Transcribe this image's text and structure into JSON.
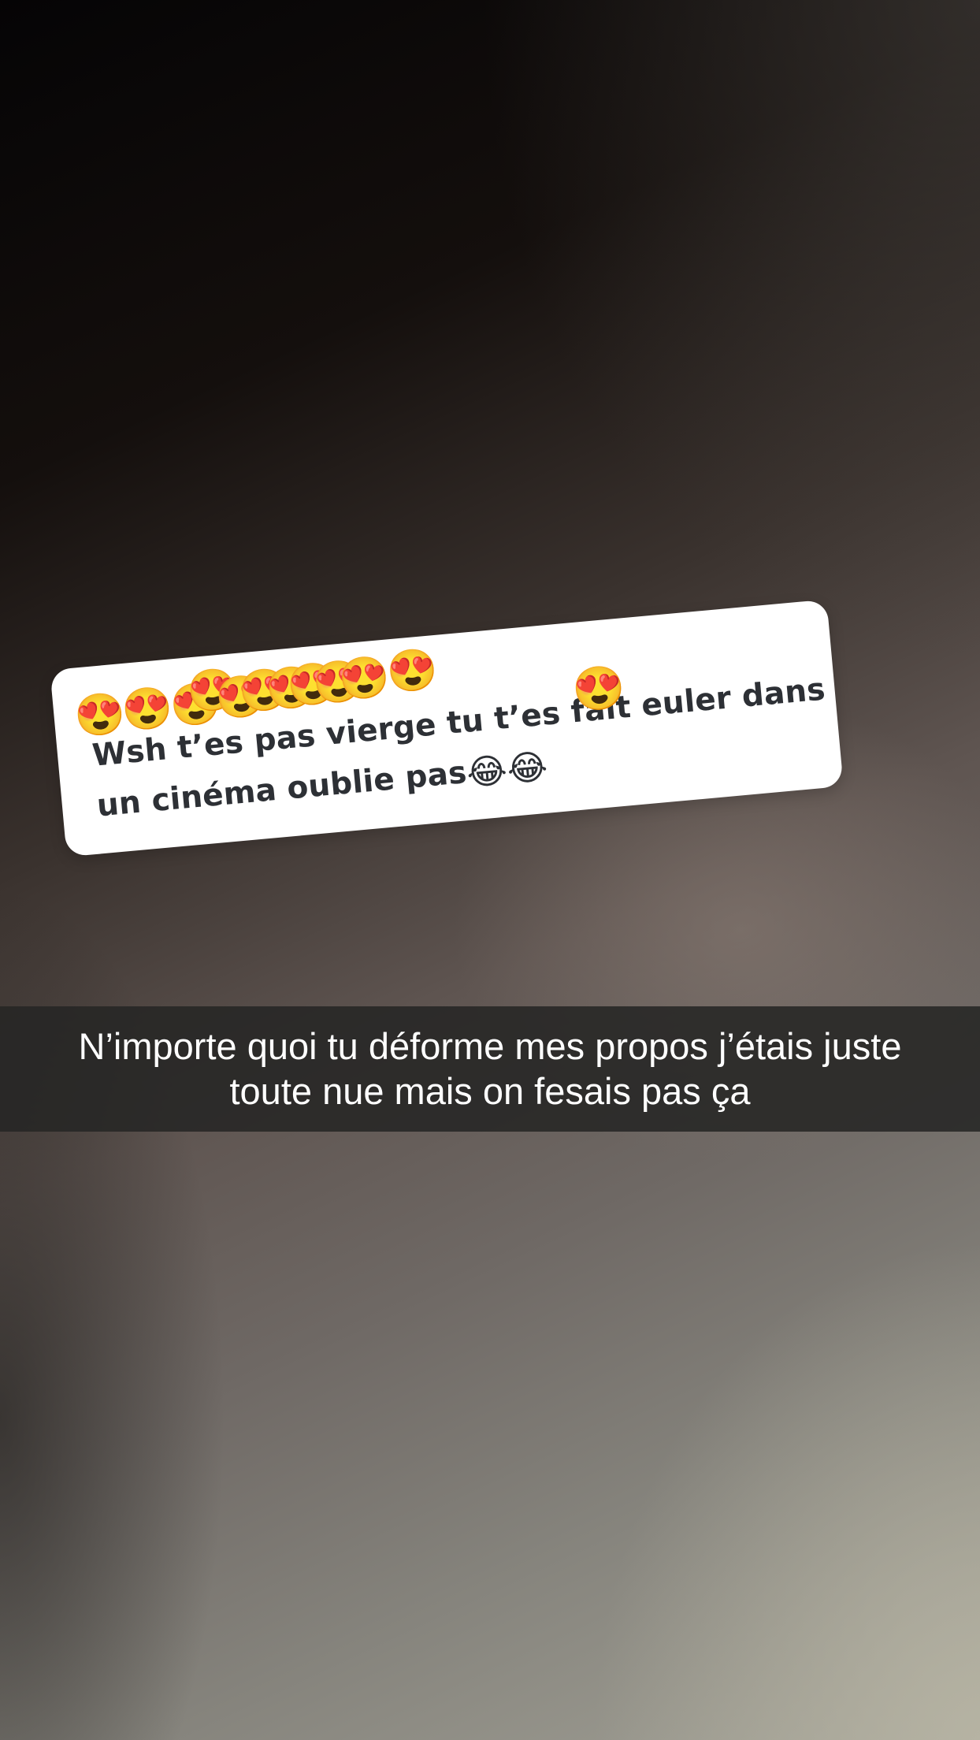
{
  "question_sticker": {
    "reaction_emojis": [
      "😍",
      "😍",
      "😍",
      "😍",
      "😍",
      "😍",
      "😍",
      "😍",
      "😍",
      "😍",
      "😍"
    ],
    "text_line_1_before": "Wsh t’es pas vierge tu t’es fait e",
    "overlay_emoji": "😍",
    "text_line_1_after": "uler dans",
    "text_line_2": "un cinéma oublie pas",
    "line_2_emojis": "😂😂"
  },
  "caption": {
    "line_1": "N’importe quoi tu déforme mes propos j’étais juste",
    "line_2": "toute nue mais on fesais pas ça"
  }
}
